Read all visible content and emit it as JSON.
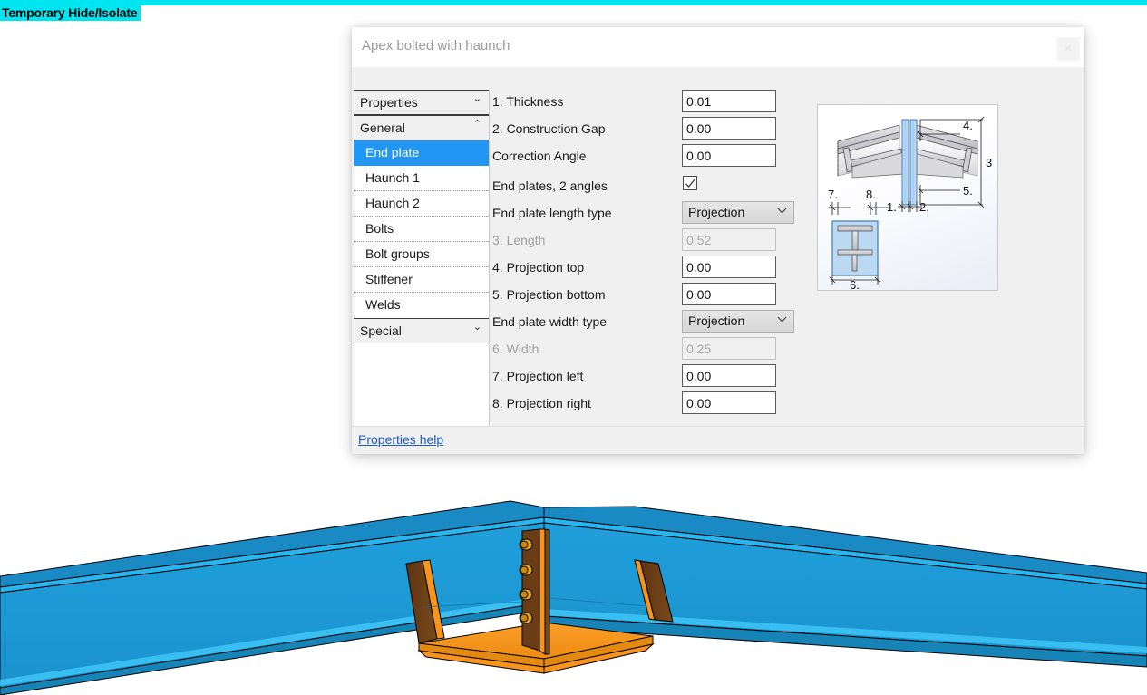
{
  "overlay": {
    "hide_isolate_label": "Temporary Hide/Isolate",
    "strip_color": "#00e5f0"
  },
  "dialog": {
    "title": "Apex bolted with haunch",
    "close_label": "×",
    "footer": {
      "help_link": "Properties help"
    },
    "nav": {
      "groups": [
        {
          "label": "Properties",
          "state": "collapsed",
          "chevron": "chevron-double-down-icon"
        },
        {
          "label": "General",
          "state": "expanded",
          "chevron": "chevron-double-up-icon"
        },
        {
          "label": "Special",
          "state": "collapsed",
          "chevron": "chevron-double-down-icon"
        }
      ],
      "items": [
        {
          "label": "End plate",
          "selected": true
        },
        {
          "label": "Haunch 1",
          "selected": false
        },
        {
          "label": "Haunch 2",
          "selected": false
        },
        {
          "label": "Bolts",
          "selected": false
        },
        {
          "label": "Bolt groups",
          "selected": false
        },
        {
          "label": "Stiffener",
          "selected": false
        },
        {
          "label": "Welds",
          "selected": false
        }
      ]
    },
    "fields": [
      {
        "label": "1. Thickness",
        "type": "text",
        "value": "0.01",
        "disabled": false
      },
      {
        "label": "2. Construction Gap",
        "type": "text",
        "value": "0.00",
        "disabled": false
      },
      {
        "label": "Correction Angle",
        "type": "text",
        "value": "0.00",
        "disabled": false
      },
      {
        "label": "End plates, 2 angles",
        "type": "checkbox",
        "value": "checked",
        "disabled": false
      },
      {
        "label": "End plate length type",
        "type": "select",
        "value": "Projection",
        "disabled": false
      },
      {
        "label": "3. Length",
        "type": "text",
        "value": "0.52",
        "disabled": true
      },
      {
        "label": "4. Projection top",
        "type": "text",
        "value": "0.00",
        "disabled": false
      },
      {
        "label": "5. Projection bottom",
        "type": "text",
        "value": "0.00",
        "disabled": false
      },
      {
        "label": "End plate width type",
        "type": "select",
        "value": "Projection",
        "disabled": false
      },
      {
        "label": "6. Width",
        "type": "text",
        "value": "0.25",
        "disabled": true
      },
      {
        "label": "7. Projection left",
        "type": "text",
        "value": "0.00",
        "disabled": false
      },
      {
        "label": "8. Projection right",
        "type": "text",
        "value": "0.00",
        "disabled": false
      }
    ],
    "diagram": {
      "name": "end-plate-dimension-diagram",
      "callouts": [
        "1.",
        "2.",
        "3",
        "4.",
        "5.",
        "6.",
        "7.",
        "8."
      ]
    }
  },
  "model": {
    "name": "apex-bolted-haunch-3d-model",
    "colors": {
      "beam": "#1f9fdb",
      "beam_light": "#29b6f0",
      "beam_dark": "#1682b4",
      "plate": "#f7941e",
      "haunch": "#6b3d16",
      "bolt": "#e8a317",
      "outline": "#000000"
    }
  }
}
